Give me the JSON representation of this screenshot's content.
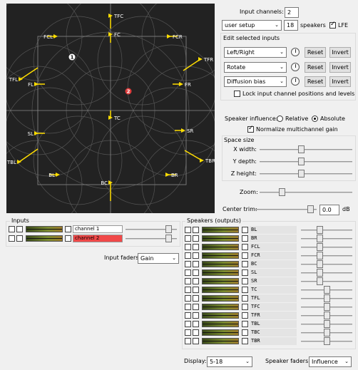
{
  "canvas": {
    "sources": [
      {
        "num": "1",
        "color": "#ffffff",
        "text_color": "#000000"
      },
      {
        "num": "2",
        "color": "#e03c3c",
        "text_color": "#ffffff"
      }
    ],
    "speaker_labels": [
      "TFC",
      "FC",
      "FCL",
      "FCR",
      "TFL",
      "TFR",
      "FL",
      "FR",
      "TC",
      "SL",
      "SR",
      "TBL",
      "TBR",
      "BL",
      "BR",
      "BC"
    ],
    "speaker_color": "#ffdd00"
  },
  "input_channels": {
    "label": "Input channels:",
    "value": "2"
  },
  "setup": {
    "value": "user setup",
    "count": "18",
    "speakers_label": "speakers",
    "lfe_label": "LFE",
    "lfe_checked": true
  },
  "edit": {
    "title": "Edit selected inputs",
    "rows": [
      {
        "mode": "Left/Right",
        "reset": "Reset",
        "invert": "Invert"
      },
      {
        "mode": "Rotate",
        "reset": "Reset",
        "invert": "Invert"
      },
      {
        "mode": "Diffusion bias",
        "reset": "Reset",
        "invert": "Invert"
      }
    ],
    "lock_label": "Lock input channel positions and levels"
  },
  "influence": {
    "label": "Speaker influence:",
    "relative": "Relative",
    "absolute": "Absolute",
    "selected": "Absolute",
    "normalize": "Normalize multichannel gain"
  },
  "space": {
    "title": "Space size",
    "x": "X width:",
    "y": "Y depth:",
    "z": "Z height:",
    "levels": [
      0.45,
      0.45,
      0.45
    ]
  },
  "zoom": {
    "label": "Zoom:",
    "level": 0.22
  },
  "center_trim": {
    "label": "Center trim:",
    "value": "0.0",
    "unit": "dB",
    "level": 0.95
  },
  "inputs": {
    "title": "Inputs",
    "channels": [
      {
        "name": "channel 1",
        "color": "#ffffff"
      },
      {
        "name": "channel 2",
        "color": "#f04848"
      }
    ],
    "faders_label": "Input faders:",
    "faders_value": "Gain"
  },
  "speakers": {
    "title": "Speakers (outputs)",
    "names": [
      "BL",
      "BR",
      "FCL",
      "FCR",
      "BC",
      "SL",
      "SR",
      "TC",
      "TFL",
      "TFC",
      "TFR",
      "TBL",
      "TBC",
      "TBR"
    ],
    "fader_levels": [
      0.35,
      0.35,
      0.35,
      0.35,
      0.35,
      0.35,
      0.35,
      0.5,
      0.5,
      0.5,
      0.5,
      0.5,
      0.5,
      0.5
    ]
  },
  "display": {
    "label": "Display:",
    "value": "5-18"
  },
  "speaker_faders": {
    "label": "Speaker faders:",
    "value": "Influence"
  }
}
